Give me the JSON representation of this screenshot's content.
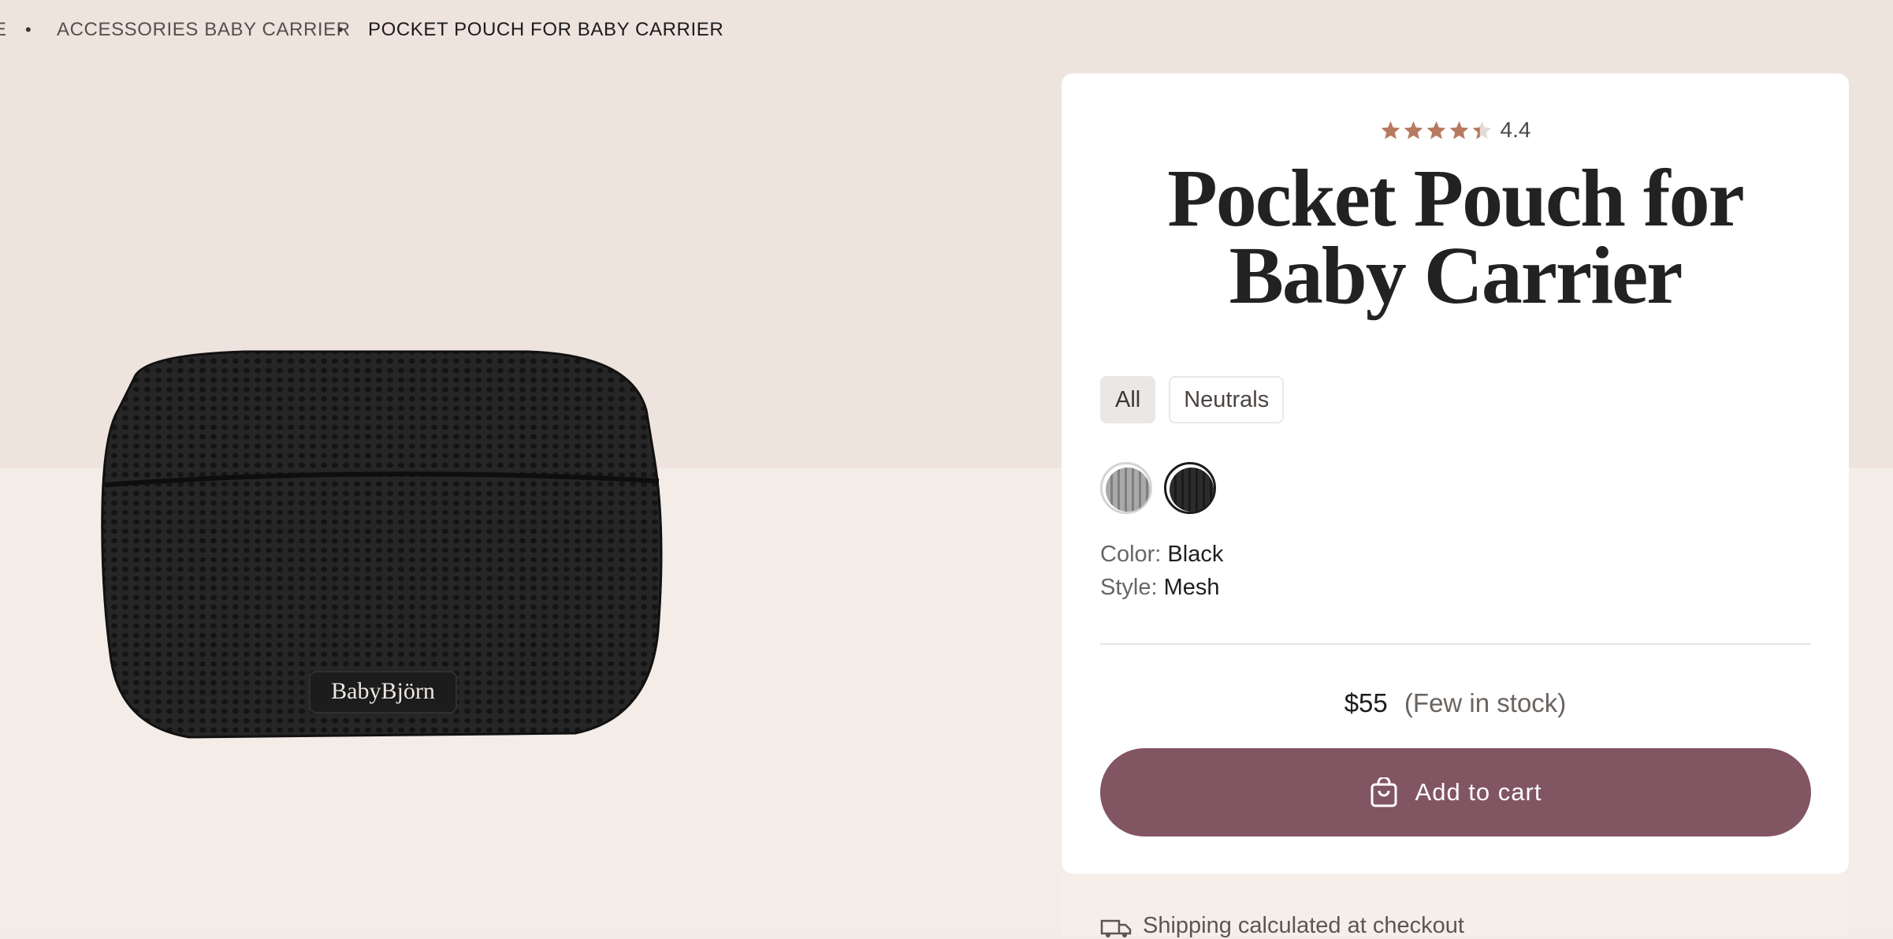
{
  "breadcrumb": {
    "cut_item": "E",
    "items": [
      "ACCESSORIES BABY CARRIER",
      "POCKET POUCH FOR BABY CARRIER"
    ],
    "separator": "•"
  },
  "product_image": {
    "logo_text": "BabyBjörn"
  },
  "product": {
    "rating": "4.4",
    "rating_stars": 4.4,
    "title": "Pocket Pouch for Baby Carrier",
    "filters": [
      "All",
      "Neutrals"
    ],
    "selected_filter": "All",
    "swatches": [
      "grey-mesh",
      "black-mesh"
    ],
    "selected_swatch": "black-mesh",
    "color_label": "Color:",
    "color_value": "Black",
    "style_label": "Style:",
    "style_value": "Mesh",
    "price": "$55",
    "stock": "(Few in stock)",
    "add_to_cart": "Add to cart",
    "shipping_text": "Shipping calculated at checkout"
  },
  "colors": {
    "accent_button": "#825563",
    "star": "#b77a5e",
    "page_bg_top": "#efe3de",
    "page_bg_bottom": "#f4ece7"
  },
  "icons": [
    "star-icon",
    "shopping-bag-icon",
    "truck-icon"
  ]
}
